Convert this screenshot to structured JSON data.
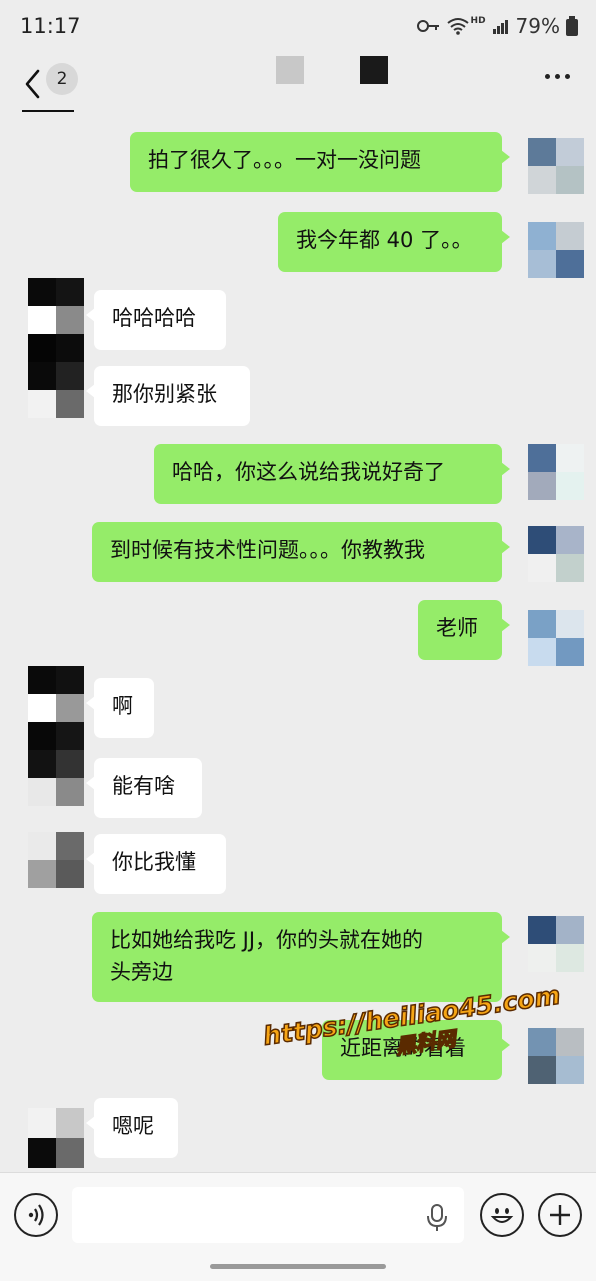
{
  "status_bar": {
    "time": "11:17",
    "network_tag": "HD",
    "battery_percent": "79%"
  },
  "nav": {
    "unread_count": "2"
  },
  "messages": [
    {
      "side": "right",
      "text": "拍了很久了。。。一对一没问题"
    },
    {
      "side": "right",
      "text": "我今年都 40 了。。"
    },
    {
      "side": "left",
      "text": "哈哈哈哈"
    },
    {
      "side": "left",
      "text": "那你别紧张"
    },
    {
      "side": "right",
      "text": "哈哈，你这么说给我说好奇了"
    },
    {
      "side": "right",
      "text": "到时候有技术性问题。。。你教教我"
    },
    {
      "side": "right",
      "text": "老师"
    },
    {
      "side": "left",
      "text": "啊"
    },
    {
      "side": "left",
      "text": "能有啥"
    },
    {
      "side": "left",
      "text": "你比我懂"
    },
    {
      "side": "right",
      "text_line1": "比如她给我吃 JJ，你的头就在她的",
      "text_line2": "头旁边"
    },
    {
      "side": "right",
      "text": "近距离的看着"
    },
    {
      "side": "left",
      "text": "嗯呢"
    }
  ],
  "watermark": {
    "line1": "https://heiliao45.com",
    "line2": "黑料网"
  },
  "colors": {
    "sent_bubble": "#95ec69",
    "received_bubble": "#ffffff",
    "chat_background": "#ededed"
  },
  "icons": {
    "back": "back-chevron-icon",
    "more": "more-dots-icon",
    "voice": "voice-input-icon",
    "mic": "microphone-icon",
    "emoji": "emoji-icon",
    "plus": "plus-icon"
  }
}
